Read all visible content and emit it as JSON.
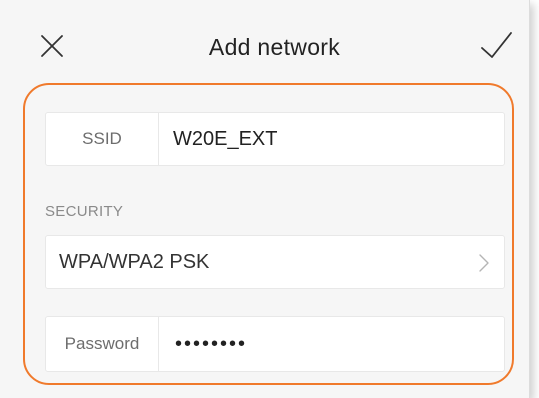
{
  "header": {
    "title": "Add network",
    "close_icon": "close-icon",
    "confirm_icon": "checkmark-icon"
  },
  "form": {
    "ssid": {
      "label": "SSID",
      "value": "W20E_EXT"
    },
    "security": {
      "section_label": "SECURITY",
      "value": "WPA/WPA2 PSK",
      "icon": "chevron-right-icon"
    },
    "password": {
      "label": "Password",
      "value": "••••••••"
    }
  },
  "colors": {
    "accent": "#f07a2c",
    "background": "#f6f6f6",
    "field_background": "#ffffff"
  }
}
